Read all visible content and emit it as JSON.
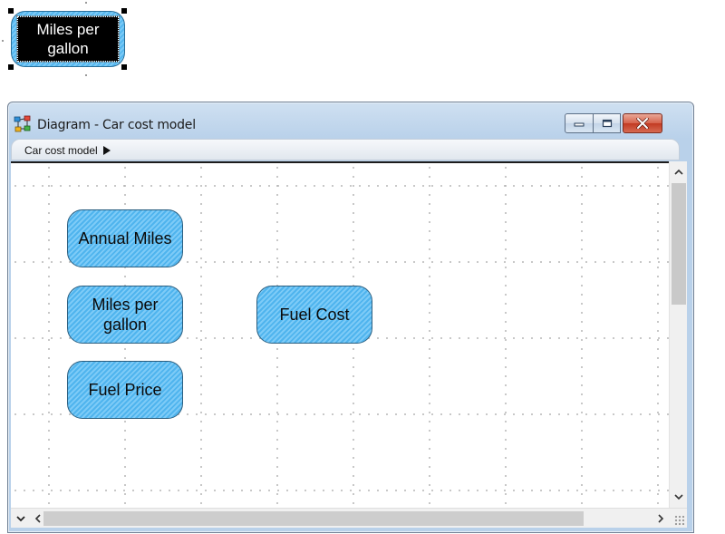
{
  "selected_node": {
    "label": "Miles per gallon"
  },
  "window": {
    "title": "Diagram - Car cost model",
    "icon": "diagram-icon"
  },
  "breadcrumb": {
    "label": "Car cost model",
    "icon": "play-triangle-icon"
  },
  "diagram": {
    "nodes": [
      {
        "id": "annual-miles",
        "label": "Annual Miles"
      },
      {
        "id": "miles-per-gallon",
        "label": "Miles per gallon"
      },
      {
        "id": "fuel-price",
        "label": "Fuel Price"
      },
      {
        "id": "fuel-cost",
        "label": "Fuel Cost"
      }
    ],
    "node_color": "#55b8f0",
    "selection_fill": "#000000"
  },
  "window_controls": {
    "minimize": "minimize-icon",
    "maximize": "maximize-icon",
    "close": "close-icon",
    "close_color": "#c8442b"
  }
}
